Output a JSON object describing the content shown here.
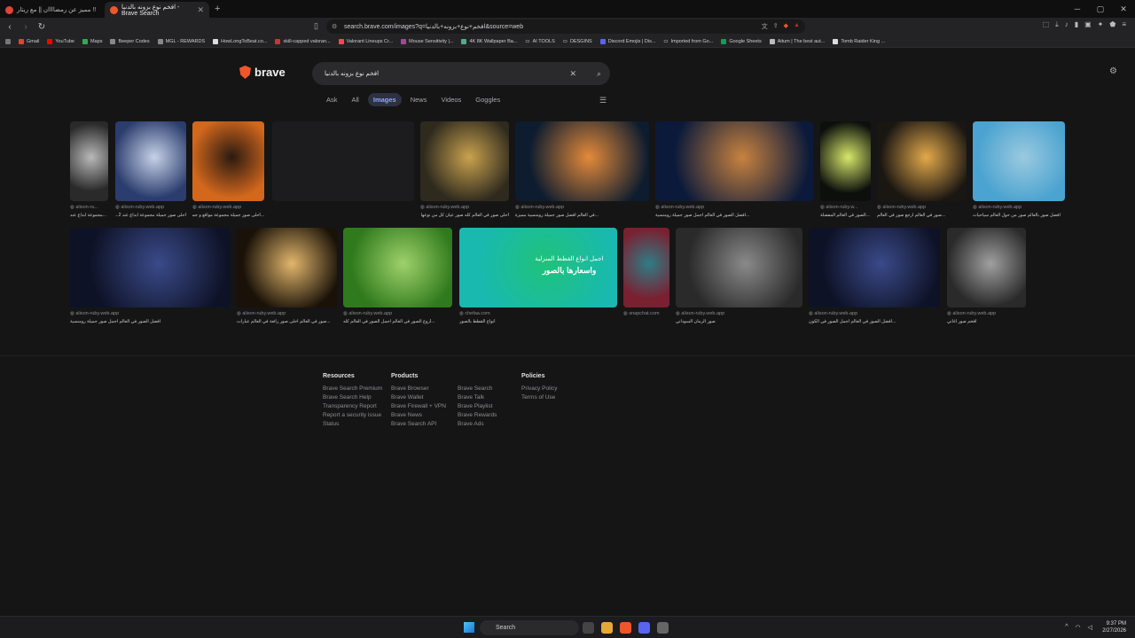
{
  "browser": {
    "tabs": [
      {
        "title": "مميز عن رمضاااان || مع ريتار !!"
      },
      {
        "title": "افخم نوع بزونه بالدنيا - Brave Search"
      }
    ],
    "address_bar": "search.brave.com/images?q=افخم+نوع+بزونه+بالدنيا&source=web",
    "bookmarks": [
      "Gmail",
      "YouTube",
      "Maps",
      "Beeper Codes",
      "MGL - REWARDS",
      "HowLongToBeat.co...",
      "skill-capped valoran...",
      "Valorant Lineups Cr...",
      "Mouse Sensitivity |...",
      "4K 8K Wallpaper Ba...",
      "AI TOOLS",
      "DESGINS",
      "Discord Emojis | Dis...",
      "Imported from Go...",
      "Google Sheets",
      "Aitum | The best aut...",
      "Tomb Raider King ..."
    ]
  },
  "search": {
    "logo_text": "brave",
    "query": "افخم نوع بزونه بالدنيا",
    "tabs": [
      "Ask",
      "All",
      "Images",
      "News",
      "Videos",
      "Goggles"
    ],
    "active_tab": "Images"
  },
  "results": {
    "row1": [
      {
        "source": "alison-ru...",
        "caption": "...مجموعة ابداع عند",
        "colors": [
          "#2a2a2a",
          "#b9b9b9"
        ]
      },
      {
        "source": "alison-ruby.web.app",
        "caption": "أحلى صور جميلة مجموعة ابداع عند 2...",
        "colors": [
          "#2b3d6e",
          "#c7d2e8"
        ]
      },
      {
        "source": "alison-ruby.web.app",
        "caption": "...أحلى صور جميلة مجموعة مواقع و جميلة",
        "colors": [
          "#d3681d",
          "#2b1a10"
        ]
      },
      {
        "source": "",
        "caption": "",
        "colors": [
          "#1c1c1e",
          "#1c1c1e"
        ]
      },
      {
        "source": "alison-ruby.web.app",
        "caption": "أحلى صور في العالم كله صور عيان كل من نوعها كارز",
        "colors": [
          "#2f2a1e",
          "#c9a24e"
        ]
      },
      {
        "source": "alison-ruby.web.app",
        "caption": "...في العالم افضل صور جميلة رومنسية مميزة",
        "colors": [
          "#0d1c2e",
          "#e38a3a"
        ]
      },
      {
        "source": "alison-ruby.web.app",
        "caption": "...افضل الصور في العالم اجمل صور جميلة رومنسية",
        "colors": [
          "#0b1a3a",
          "#c8823f"
        ]
      },
      {
        "source": "alison-ruby.w...",
        "caption": "...الصور في العالم المفضلة",
        "colors": [
          "#0c0f0c",
          "#d7e86a"
        ]
      },
      {
        "source": "alison-ruby.web.app",
        "caption": "...صور في العالم ارجع صور في العالم",
        "colors": [
          "#1a1612",
          "#e3a94a"
        ]
      },
      {
        "source": "alison-ruby.web.app",
        "caption": "افضل صور بالعالم صور من حول العالم سياحيات",
        "colors": [
          "#4aa3d0",
          "#9bc9e0"
        ]
      }
    ],
    "row2": [
      {
        "source": "alison-ruby.web.app",
        "caption": "افضل الصور في العالم اجمل صور جميلة رومنسية",
        "colors": [
          "#0e1226",
          "#3a4a8a"
        ]
      },
      {
        "source": "alison-ruby.web.app",
        "caption": "...صور في العالم احلى صور رائعة في العالم عبارات",
        "colors": [
          "#1a1208",
          "#e2b66c"
        ]
      },
      {
        "source": "alison-ruby.web.app",
        "caption": "...أروع الصور في العالم اجمل الصور في العالم كله",
        "colors": [
          "#2f7a1c",
          "#9fd16b"
        ]
      },
      {
        "source": "chefaa.com",
        "caption": "أنواع القطط بالصور",
        "colors": [
          "#19b9b0",
          "#1fc27a"
        ]
      },
      {
        "source": "snapchat.com",
        "caption": "",
        "colors": [
          "#7a2031",
          "#2e7d86"
        ]
      },
      {
        "source": "alison-ruby.web.app",
        "caption": "صور الرمان السوداني",
        "colors": [
          "#2a2a2a",
          "#8a8a8a"
        ]
      },
      {
        "source": "alison-ruby.web.app",
        "caption": "...افضل الصور في العالم اجمل الصور في الكون",
        "colors": [
          "#0e1226",
          "#3a4a8a"
        ]
      },
      {
        "source": "alison-ruby.web.app",
        "caption": "افخم صور اغاني",
        "colors": [
          "#2a2a2a",
          "#a0a0a0"
        ]
      }
    ],
    "chefaa_banner": {
      "line1": "اجمل انواع القطط المنزلية",
      "line2": "واسعارها بالصور"
    }
  },
  "footer": {
    "resources": {
      "title": "Resources",
      "items": [
        "Brave Search Premium",
        "Brave Search Help",
        "Transparency Report",
        "Report a security issue",
        "Status"
      ]
    },
    "products": {
      "title": "Products",
      "col1": [
        "Brave Browser",
        "Brave Wallet",
        "Brave Firewall + VPN",
        "Brave News",
        "Brave Search API"
      ],
      "col2": [
        "Brave Search",
        "Brave Talk",
        "Brave Playlist",
        "Brave Rewards",
        "Brave Ads"
      ]
    },
    "policies": {
      "title": "Policies",
      "items": [
        "Privacy Policy",
        "Terms of Use"
      ]
    }
  },
  "taskbar": {
    "search_label": "Search",
    "time": "9:37 PM",
    "date": "2/27/2026"
  }
}
